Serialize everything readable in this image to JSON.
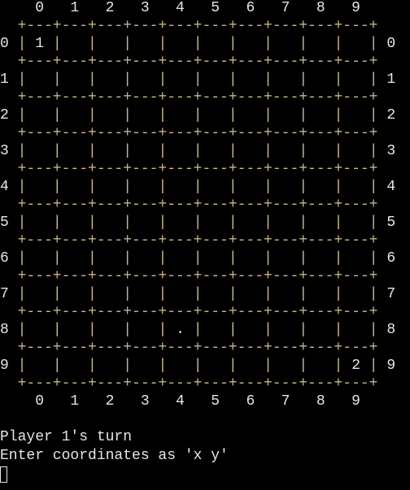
{
  "column_labels": [
    "0",
    "1",
    "2",
    "3",
    "4",
    "5",
    "6",
    "7",
    "8",
    "9"
  ],
  "row_labels": [
    "0",
    "1",
    "2",
    "3",
    "4",
    "5",
    "6",
    "7",
    "8",
    "9"
  ],
  "border_line": "+---+---+---+---+---+---+---+---+---+---+",
  "separator": "|",
  "board": [
    [
      "1",
      " ",
      " ",
      " ",
      " ",
      " ",
      " ",
      " ",
      " ",
      " "
    ],
    [
      " ",
      " ",
      " ",
      " ",
      " ",
      " ",
      " ",
      " ",
      " ",
      " "
    ],
    [
      " ",
      " ",
      " ",
      " ",
      " ",
      " ",
      " ",
      " ",
      " ",
      " "
    ],
    [
      " ",
      " ",
      " ",
      " ",
      " ",
      " ",
      " ",
      " ",
      " ",
      " "
    ],
    [
      " ",
      " ",
      " ",
      " ",
      " ",
      " ",
      " ",
      " ",
      " ",
      " "
    ],
    [
      " ",
      " ",
      " ",
      " ",
      " ",
      " ",
      " ",
      " ",
      " ",
      " "
    ],
    [
      " ",
      " ",
      " ",
      " ",
      " ",
      " ",
      " ",
      " ",
      " ",
      " "
    ],
    [
      " ",
      " ",
      " ",
      " ",
      " ",
      " ",
      " ",
      " ",
      " ",
      " "
    ],
    [
      " ",
      " ",
      " ",
      " ",
      ".",
      " ",
      " ",
      " ",
      " ",
      " "
    ],
    [
      " ",
      " ",
      " ",
      " ",
      " ",
      " ",
      " ",
      " ",
      " ",
      "2"
    ]
  ],
  "status": {
    "turn_text": "Player 1's turn",
    "prompt_text": "Enter coordinates as 'x y'"
  }
}
